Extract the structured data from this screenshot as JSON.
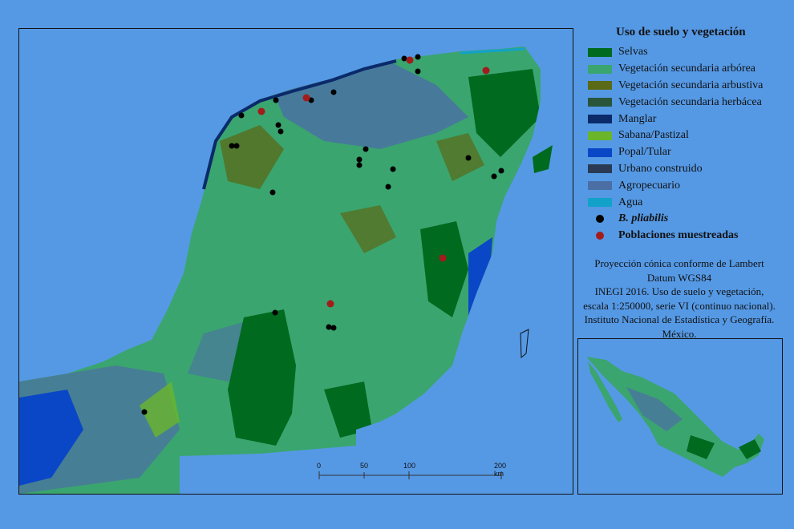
{
  "legend": {
    "title": "Uso de suelo y vegetación",
    "items": [
      {
        "label": "Selvas",
        "color": "#006a1f"
      },
      {
        "label": "Vegetación secundaria arbórea",
        "color": "#3aa56f"
      },
      {
        "label": "Vegetación secundaria arbustiva",
        "color": "#5a6a16"
      },
      {
        "label": "Vegetación secundaria herbácea",
        "color": "#29563a"
      },
      {
        "label": "Manglar",
        "color": "#0a2a6a"
      },
      {
        "label": "Sabana/Pastizal",
        "color": "#6ab52a"
      },
      {
        "label": "Popal/Tular",
        "color": "#0a47c7"
      },
      {
        "label": "Urbano construido",
        "color": "#2a3a55"
      },
      {
        "label": "Agropecuario",
        "color": "#4b6fa5"
      },
      {
        "label": "Agua",
        "color": "#12a2c9"
      }
    ],
    "points": [
      {
        "label": "B. pliabilis",
        "color": "#000000"
      },
      {
        "label": "Poblaciones muestreadas",
        "color": "#a21c1c"
      }
    ]
  },
  "credits": [
    "Proyección cónica conforme de Lambert",
    "Datum WGS84",
    "INEGI 2016. Uso de suelo y vegetación,",
    "escala 1:250000, serie VI (continuo nacional).",
    "Instituto Nacional de Estadística y Geografía.",
    "México."
  ],
  "scale_bar": {
    "labels": [
      "0",
      "50",
      "100",
      "200 km"
    ]
  }
}
